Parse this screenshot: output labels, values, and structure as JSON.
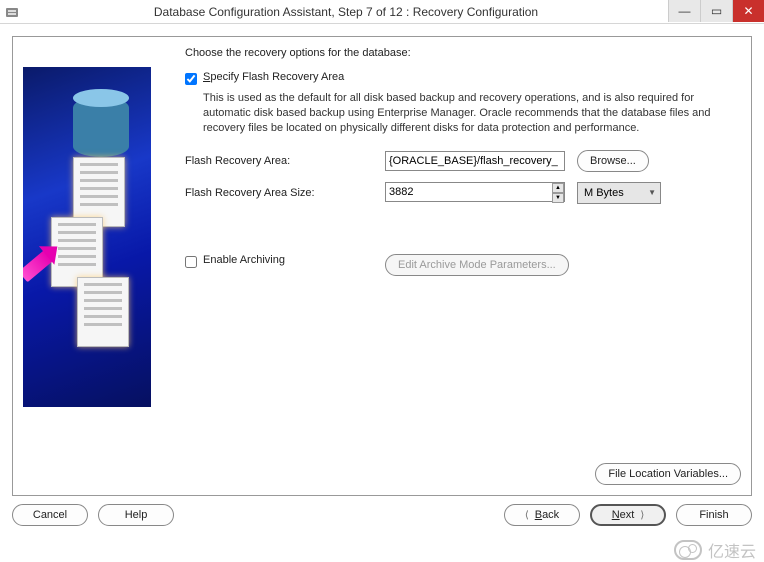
{
  "titlebar": {
    "title": "Database Configuration Assistant, Step 7 of 12 : Recovery Configuration",
    "minimize": "—",
    "maximize": "▭",
    "close": "✕"
  },
  "main": {
    "instruction": "Choose the recovery options for the database:",
    "flash_checkbox_label_pre": "",
    "flash_checkbox_mnemonic": "S",
    "flash_checkbox_label_post": "pecify Flash Recovery Area",
    "flash_checked": true,
    "flash_description": "This is used as the default for all disk based backup and recovery operations, and is also required for automatic disk based backup using Enterprise Manager. Oracle recommends that the database files and recovery files be located on physically different disks for data protection and performance.",
    "flash_area_label": "Flash Recovery Area:",
    "flash_area_value": "{ORACLE_BASE}/flash_recovery_",
    "browse_label": "Browse...",
    "flash_size_label": "Flash Recovery Area Size:",
    "flash_size_value": "3882",
    "flash_size_unit": "M Bytes",
    "archive_checkbox_label": "Enable Archiving",
    "archive_checked": false,
    "archive_params_label": "Edit Archive Mode Parameters...",
    "file_loc_label": "File Location Variables..."
  },
  "buttons": {
    "cancel": "Cancel",
    "help": "Help",
    "back_arrow": "⟨",
    "back_mn": "B",
    "back_rest": "ack",
    "next_mn": "N",
    "next_rest": "ext",
    "next_arrow": "⟩",
    "finish": "Finish"
  },
  "watermark": "亿速云"
}
